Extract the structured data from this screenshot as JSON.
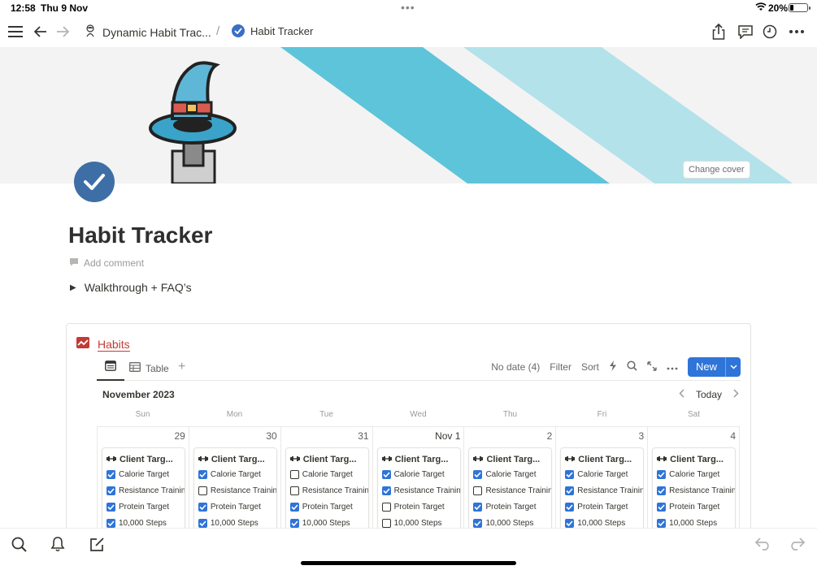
{
  "status": {
    "time": "12:58",
    "date": "Thu 9 Nov",
    "battery": "20%"
  },
  "breadcrumb": {
    "parent": "Dynamic Habit Trac...",
    "separator": "/",
    "current": "Habit Tracker"
  },
  "cover": {
    "change_label": "Change cover",
    "stripe_dark": "#5ec4d9",
    "stripe_light": "#b3e2ea"
  },
  "page": {
    "title": "Habit Tracker",
    "add_comment": "Add comment",
    "toggle_label": "Walkthrough + FAQ’s"
  },
  "database": {
    "title": "Habits",
    "views": {
      "table_label": "Table",
      "add": "+"
    },
    "tools": {
      "no_date": "No date (4)",
      "filter": "Filter",
      "sort": "Sort",
      "new": "New"
    },
    "month": "November 2023",
    "today": "Today",
    "weekdays": [
      "Sun",
      "Mon",
      "Tue",
      "Wed",
      "Thu",
      "Fri",
      "Sat"
    ],
    "days": [
      {
        "num": "29",
        "title": "Client Targ...",
        "checks": [
          true,
          true,
          true,
          true
        ]
      },
      {
        "num": "30",
        "title": "Client Targ...",
        "checks": [
          true,
          false,
          true,
          true
        ]
      },
      {
        "num": "31",
        "title": "Client Targ...",
        "checks": [
          false,
          false,
          true,
          true
        ]
      },
      {
        "num": "Nov 1",
        "title": "Client Targ...",
        "checks": [
          true,
          true,
          false,
          false
        ]
      },
      {
        "num": "2",
        "title": "Client Targ...",
        "checks": [
          true,
          false,
          true,
          true
        ]
      },
      {
        "num": "3",
        "title": "Client Targ...",
        "checks": [
          true,
          true,
          true,
          true
        ]
      },
      {
        "num": "4",
        "title": "Client Targ...",
        "checks": [
          true,
          true,
          true,
          true
        ]
      }
    ],
    "properties": [
      "Calorie Target",
      "Resistance Training",
      "Protein Target",
      "10,000 Steps"
    ]
  },
  "colors": {
    "accent": "#2f74d8",
    "habits_red": "#c23b36",
    "page_icon": "#3d6fa6"
  }
}
